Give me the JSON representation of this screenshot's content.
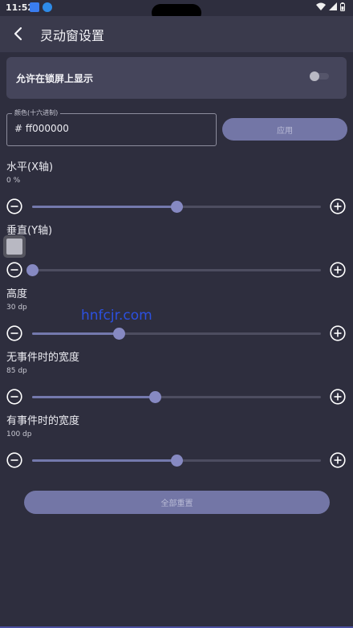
{
  "status_bar": {
    "time": "11:52",
    "icons": [
      "notification-icon",
      "download-icon",
      "wifi-icon",
      "signal-icon",
      "battery-icon"
    ],
    "icon_colors": {
      "notification": "#3a7df0",
      "download": "#2e8be8"
    }
  },
  "appbar": {
    "title": "灵动窗设置",
    "back_icon": "arrow-left-icon"
  },
  "lockscreen": {
    "label": "允许在锁屏上显示",
    "enabled": false
  },
  "color": {
    "legend": "颜色(十六进制)",
    "value": "# ff000000",
    "apply_label": "应用"
  },
  "sliders": [
    {
      "label": "水平(X轴)",
      "value_text": "0 %",
      "level": 0.5
    },
    {
      "label": "垂直(Y轴)",
      "value_text": "",
      "level": 0.0
    },
    {
      "label": "高度",
      "value_text": "30 dp",
      "level": 0.3
    },
    {
      "label": "无事件时的宽度",
      "value_text": "85 dp",
      "level": 0.425
    },
    {
      "label": "有事件时的宽度",
      "value_text": "100 dp",
      "level": 0.5
    }
  ],
  "reset_label": "全部重置",
  "watermark": "hnfcjr.com",
  "colors": {
    "background": "#2e2e3e",
    "appbar": "#3a3a4c",
    "card": "#45455b",
    "accent": "#7479ad",
    "button": "#7376a6"
  }
}
